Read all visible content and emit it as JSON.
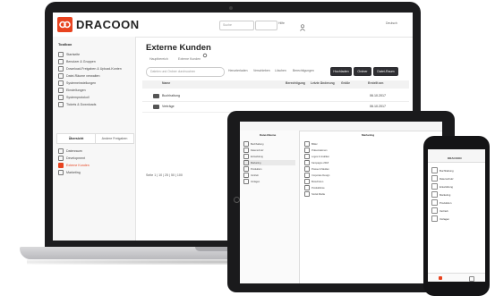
{
  "app": {
    "logo_text": "DRACOON",
    "brand_color": "#e8431f",
    "search_placeholder": "Suche",
    "top_links": [
      "Hilfe",
      "Deutsch"
    ]
  },
  "sidebar": {
    "header": "Toolbox",
    "items": [
      "Startseite",
      "Benutzer & Gruppen",
      "Download-Freigaben & Upload-Konten",
      "Datei-Räume verwalten",
      "Systemeinstellungen",
      "Einstellungen",
      "Systemprotokoll",
      "Tickets & Downloads"
    ],
    "tabs": [
      "Übersicht",
      "Andere Freigaben"
    ],
    "rooms": [
      "Datenraum",
      "Development",
      "Externe Kunden",
      "Marketing"
    ]
  },
  "main": {
    "title": "Externe Kunden",
    "breadcrumb": [
      "Hauptbereich",
      "Externe Kunden"
    ],
    "filter_placeholder": "Dateien und Ordner durchsuchen",
    "tools": [
      "Herunterladen",
      "Verschieben",
      "Löschen",
      "Berechtigungen"
    ],
    "buttons": [
      "Hochladen",
      "Ordner",
      "Datei-Raum"
    ],
    "columns": [
      "Name",
      "Berechtigung",
      "Letzte Änderung",
      "Größe",
      "Erstellt am"
    ],
    "rows": [
      {
        "name": "Buchhaltung",
        "date": "06.10.2017"
      },
      {
        "name": "Verträge",
        "date": "06.10.2017"
      }
    ],
    "pager": "Seite 1 | 10 | 25 | 50 | 100"
  },
  "tablet": {
    "left_title": "Datei-Räume",
    "right_title": "Marketing",
    "left_items": [
      "Buchhaltung",
      "Datenschutz",
      "Entwicklung",
      "Marketing",
      "Produktion",
      "Vertrieb",
      "Vorlagen"
    ],
    "right_items": [
      "Bilder",
      "Präsentationen",
      "Logos & Grafiken",
      "Kampagne 2018",
      "Presse & Medien",
      "Corporate Design",
      "Broschüren",
      "Produktfotos",
      "Social Media"
    ]
  },
  "phone": {
    "title": "DRACOON",
    "items": [
      "Buchhaltung",
      "Datenschutz",
      "Entwicklung",
      "Marketing",
      "Produktion",
      "Vertrieb",
      "Vorlagen"
    ]
  }
}
